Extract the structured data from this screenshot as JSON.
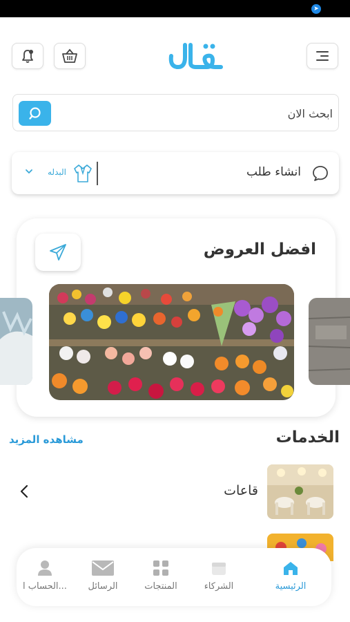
{
  "header": {
    "logo_text": "نال",
    "logo_color": "#3ab3ea",
    "menu_icon": "menu-icon",
    "cart_icon": "basket-icon",
    "notif_icon": "bell-icon"
  },
  "search": {
    "placeholder": "ابحث الان",
    "button_icon": "search-icon"
  },
  "request": {
    "label": "انشاء طلب",
    "type_label": "البدله",
    "icon": "chat-icon"
  },
  "offers": {
    "title": "افضل العروض",
    "share_icon": "send-icon"
  },
  "services": {
    "title": "الخدمات",
    "see_more": "مشاهده المزيد",
    "items": [
      {
        "label": "قاعات"
      }
    ]
  },
  "bottom_nav": {
    "items": [
      {
        "label": "الرئيسية",
        "icon": "home-icon",
        "active": true
      },
      {
        "label": "الشركاء",
        "icon": "store-icon",
        "active": false
      },
      {
        "label": "المنتجات",
        "icon": "grid-icon",
        "active": false
      },
      {
        "label": "الرسائل",
        "icon": "mail-icon",
        "active": false
      },
      {
        "label": "الحساب ا...",
        "icon": "user-icon",
        "active": false
      }
    ]
  },
  "colors": {
    "accent": "#3ab3ea",
    "link": "#2a9ad8"
  }
}
